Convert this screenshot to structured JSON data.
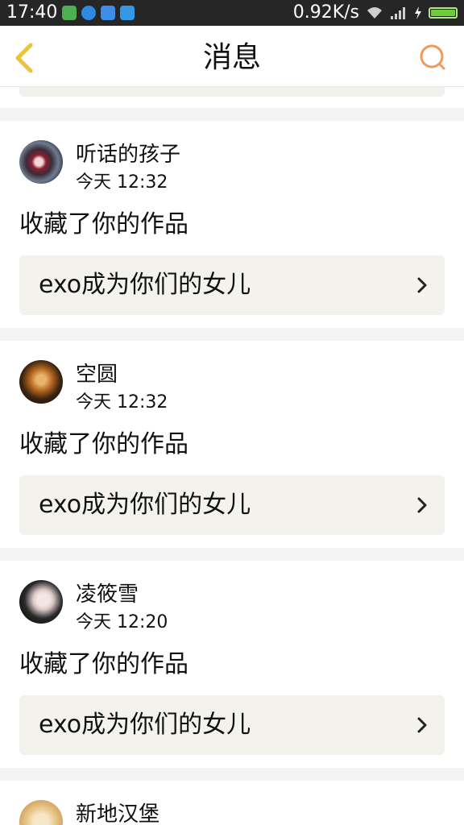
{
  "status_bar": {
    "time": "17:40",
    "net_speed": "0.92K/s",
    "icons": [
      "app-icon",
      "k-icon",
      "shield-icon",
      "signal-app-icon",
      "wifi-icon",
      "cell-signal-icon",
      "charging-icon",
      "battery-icon"
    ],
    "battery_level": 1.0
  },
  "nav": {
    "title": "消息",
    "back_icon": "chevron-left-icon",
    "search_icon": "search-icon",
    "accent_color": "#f39a5b",
    "back_color": "#e8c53a"
  },
  "messages": [
    {
      "user": "听话的孩子",
      "time": "今天 12:32",
      "action": "收藏了你的作品",
      "work_title": "exo成为你们的女儿"
    },
    {
      "user": "空圆",
      "time": "今天 12:32",
      "action": "收藏了你的作品",
      "work_title": "exo成为你们的女儿"
    },
    {
      "user": "凌筱雪",
      "time": "今天 12:20",
      "action": "收藏了你的作品",
      "work_title": "exo成为你们的女儿"
    },
    {
      "user": "新地汉堡"
    }
  ]
}
